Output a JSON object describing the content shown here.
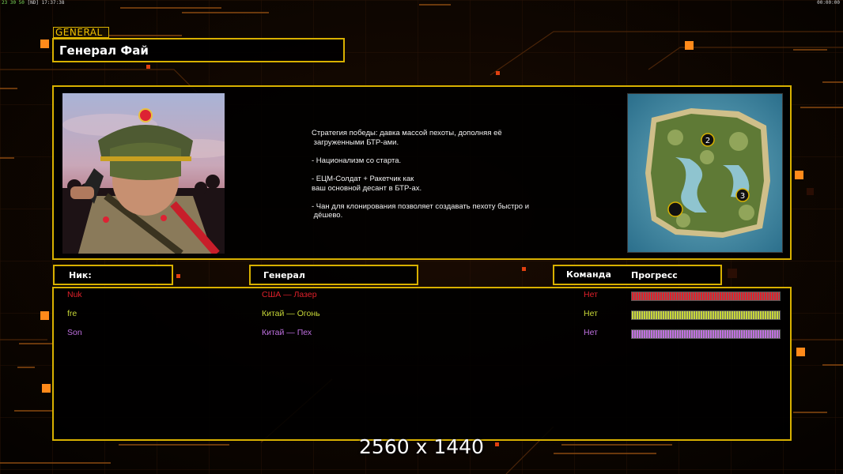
{
  "hud": {
    "left_status": "23 30 50 [ND] 17:37:38",
    "left_prefix": "23 30 50",
    "left_suffix": " [ND] 17:37:38",
    "right_clock": "00:00:00"
  },
  "general_tag": "GENERAL",
  "title": "Генерал Фай",
  "description": "Стратегия победы: давка массой пехоты, дополняя её\n загруженными БТР-ами.\n\n- Национализм со старта.\n\n- ЕЦМ-Солдат + Ракетчик как\nваш основной десант в БТР-ах.\n\n- Чан для клонирования позволяет создавать пехоту быстро и\n дёшево.",
  "minimap": {
    "start_positions": [
      "2",
      "3"
    ]
  },
  "headers": {
    "nick": "Ник:",
    "general": "Генерал",
    "team": "Команда",
    "progress": "Прогресс"
  },
  "players": [
    {
      "nick": "Nuk",
      "general": "США — Лазер",
      "team": "Нет",
      "color": "#e0202a",
      "progress": 1.0
    },
    {
      "nick": "fre",
      "general": "Китай — Огонь",
      "team": "Нет",
      "color": "#c8d838",
      "progress": 1.0
    },
    {
      "nick": "Son",
      "general": "Китай — Пех",
      "team": "Нет",
      "color": "#c070e0",
      "progress": 1.0
    }
  ],
  "resolution_caption": "2560 x 1440",
  "colors": {
    "accent_gold": "#d8b000",
    "accent_orange": "#ff8a1a",
    "grid": "#3a1c08"
  }
}
